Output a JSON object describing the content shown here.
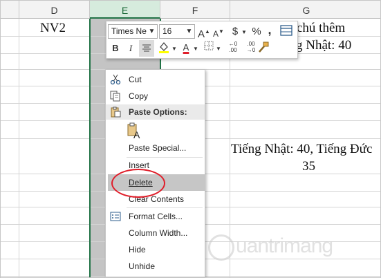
{
  "columns": [
    {
      "label": "D"
    },
    {
      "label": "E"
    },
    {
      "label": "F"
    },
    {
      "label": "G"
    }
  ],
  "cells": {
    "d1": "NV2",
    "g1": "chú thêm",
    "g2": "g Nhật: 40",
    "g8": "Tiếng Nhật: 40, Tiếng Đức",
    "g9": "35"
  },
  "mini_toolbar": {
    "font_name": "Times Ne",
    "font_size": "16",
    "grow_font": "A",
    "shrink_font": "A",
    "currency": "$",
    "percent": "%",
    "comma": ",",
    "bold": "B",
    "italic": "I",
    "font_color_letter": "A",
    "dec_increase": "←0 .00",
    "dec_decrease": ".00 →0",
    "highlight_color": "#ffff00",
    "font_color": "#e01e2a"
  },
  "context_menu": {
    "cut": "Cut",
    "copy": "Copy",
    "paste_options": "Paste Options:",
    "paste_special": "Paste Special...",
    "insert": "Insert",
    "delete": "Delete",
    "clear_contents": "Clear Contents",
    "format_cells": "Format Cells...",
    "column_width": "Column Width...",
    "hide": "Hide",
    "unhide": "Unhide"
  },
  "watermark": "uantrimang",
  "colors": {
    "selection_border": "#217346",
    "highlight_oval": "#e01e2a",
    "menu_hover": "#c6c6c6"
  }
}
